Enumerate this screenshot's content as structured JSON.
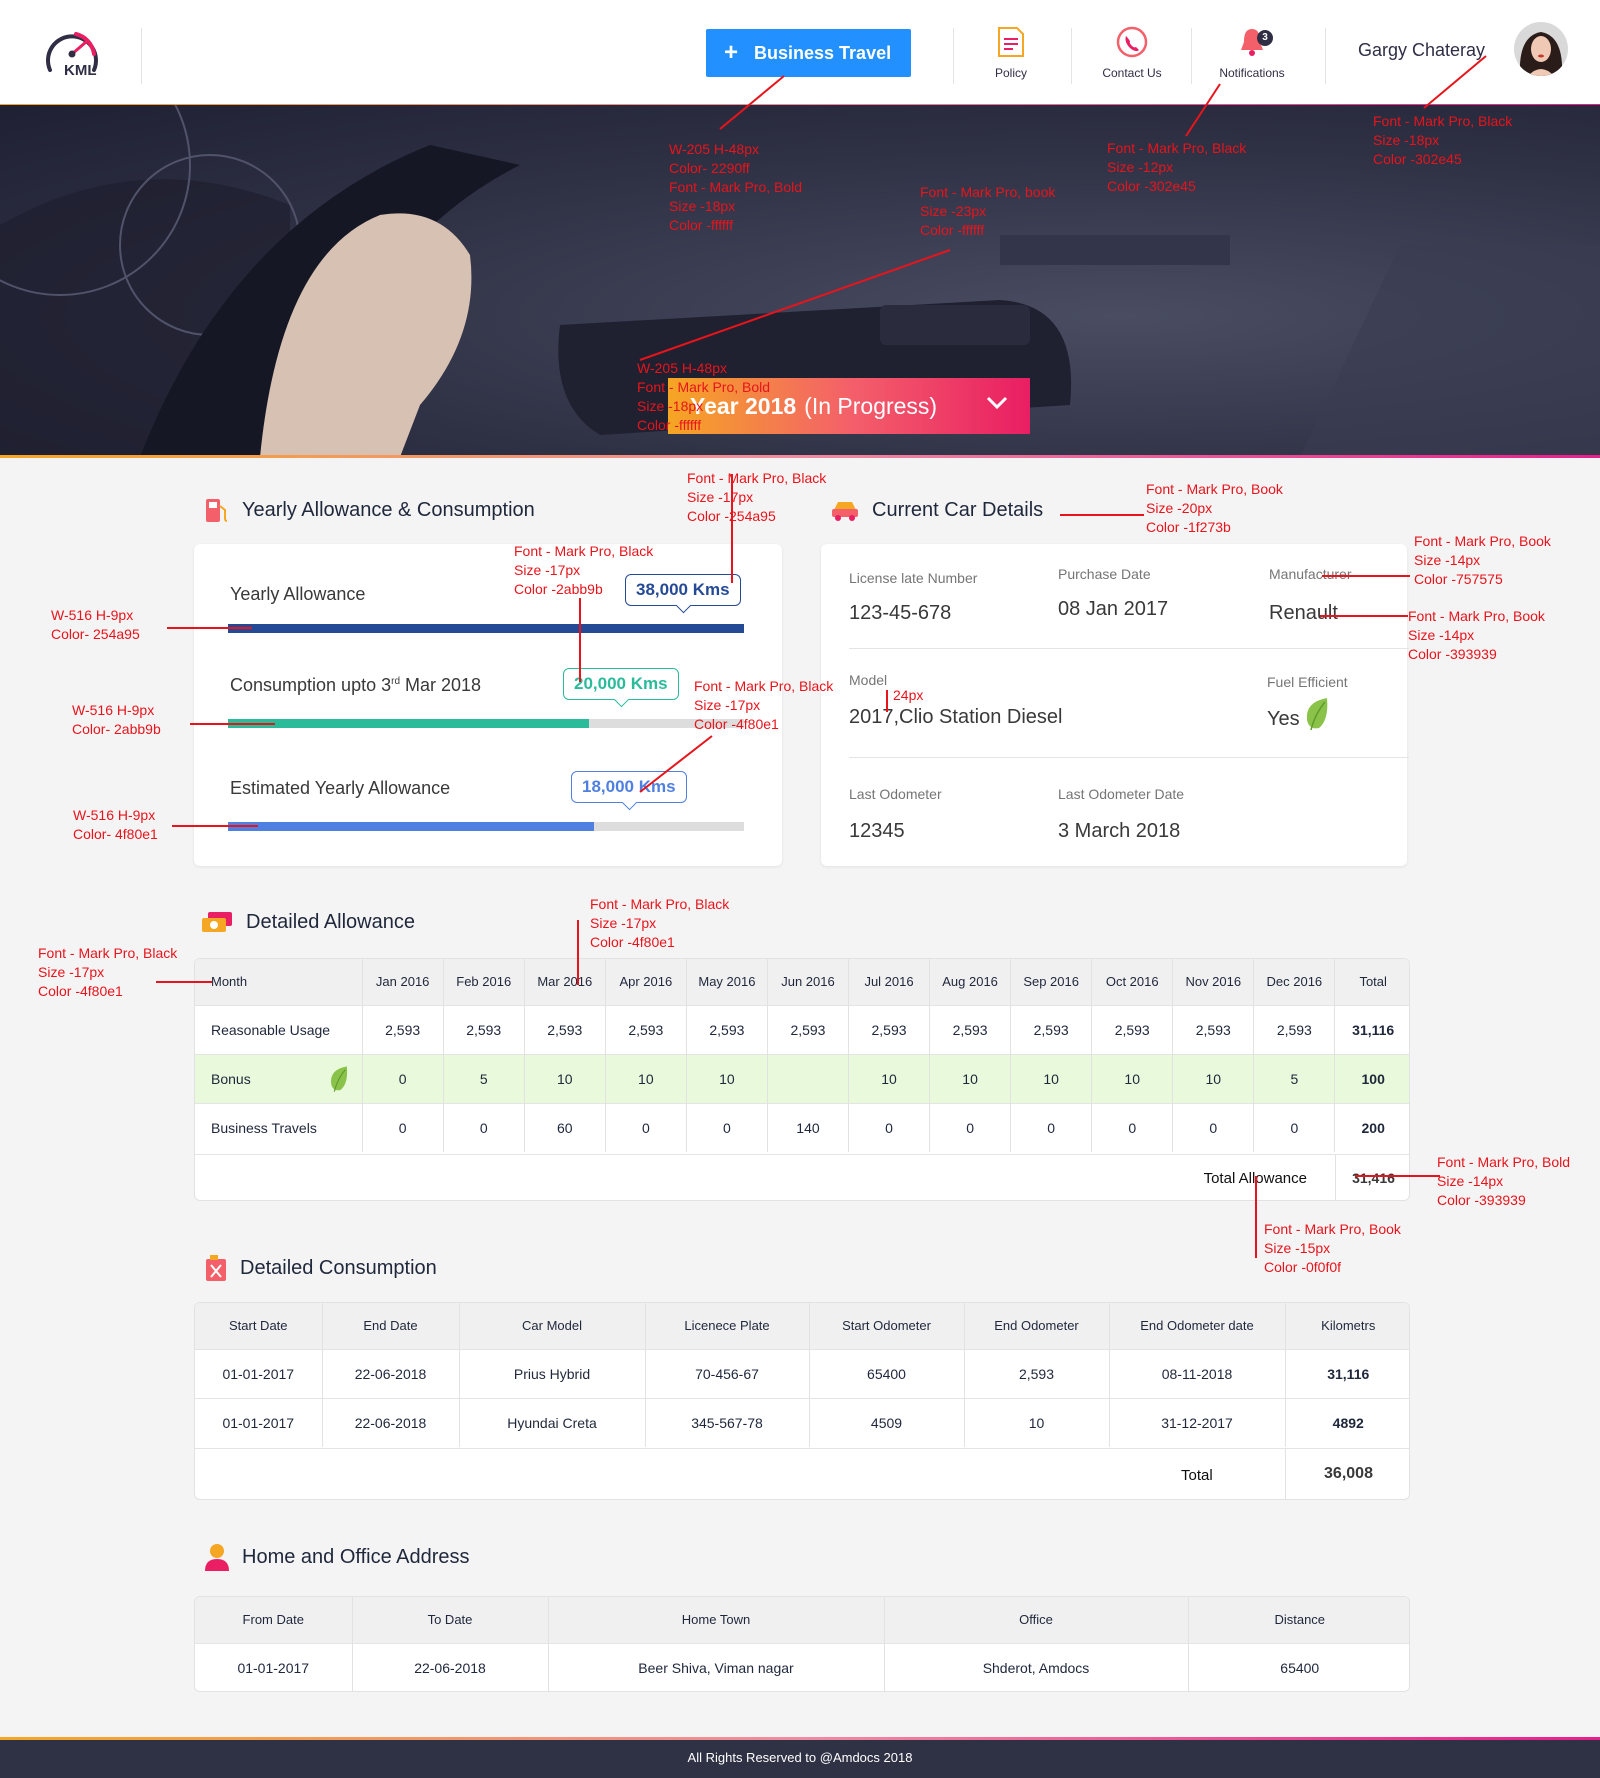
{
  "header": {
    "logo_text": "KML",
    "business_travel_label": "Business Travel",
    "nav": [
      {
        "label": "Policy",
        "icon": "policy-document-icon"
      },
      {
        "label": "Contact Us",
        "icon": "contact-phone-icon"
      },
      {
        "label": "Notifications",
        "icon": "bell-icon",
        "badge": "3"
      }
    ],
    "user_name": "Gargy Chateray"
  },
  "hero": {
    "year_bold": "Year 2018",
    "year_status": "(In Progress)"
  },
  "annotations": {
    "business_btn": [
      "W-205 H-48px",
      "Color- 2290ff",
      "Font - Mark Pro, Bold",
      "Size -18px",
      "Color -ffffff"
    ],
    "year_text": [
      "Font - Mark Pro, book",
      "Size -23px",
      "Color -ffffff"
    ],
    "year_box": [
      "W-205 H-48px",
      "Font - Mark Pro, Bold",
      "Size -18px",
      "Color -ffffff"
    ],
    "notifications": [
      "Font - Mark Pro, Black",
      "Size -12px",
      "Color -302e45"
    ],
    "username": [
      "Font - Mark Pro, Black",
      "Size -18px",
      "Color -302e45"
    ],
    "bubble_blue": [
      "Font - Mark Pro, Black",
      "Size -17px",
      "Color -254a95"
    ],
    "bubble_green": [
      "Font - Mark Pro, Black",
      "Size -17px",
      "Color -2abb9b"
    ],
    "bubble_light": [
      "Font - Mark Pro, Black",
      "Size -17px",
      "Color -4f80e1"
    ],
    "bar1": [
      "W-516 H-9px",
      "Color- 254a95"
    ],
    "bar2": [
      "W-516 H-9px",
      "Color- 2abb9b"
    ],
    "bar3": [
      "W-516 H-9px",
      "Color- 4f80e1"
    ],
    "car_title": [
      "Font - Mark Pro, Book",
      "Size -20px",
      "Color -1f273b"
    ],
    "car_label": [
      "Font - Mark Pro, Book",
      "Size -14px",
      "Color -757575"
    ],
    "car_value": [
      "Font - Mark Pro, Book",
      "Size -14px",
      "Color -393939"
    ],
    "model_gap": [
      "24px"
    ],
    "month_col": [
      "Font - Mark Pro, Black",
      "Size -17px",
      "Color -4f80e1"
    ],
    "month_header": [
      "Font - Mark Pro, Black",
      "Size -17px",
      "Color -4f80e1"
    ],
    "total_value": [
      "Font - Mark Pro, Bold",
      "Size -14px",
      "Color -393939"
    ],
    "total_label": [
      "Font - Mark Pro, Book",
      "Size -15px",
      "Color -0f0f0f"
    ]
  },
  "allowance": {
    "title": "Yearly Allowance & Consumption",
    "rows": [
      {
        "label": "Yearly Allowance",
        "bubble": "38,000 Kms",
        "fill": 1.0,
        "color": "#254a95"
      },
      {
        "label_pre": "Consumption upto 3",
        "label_sup": "rd",
        "label_post": " Mar 2018",
        "bubble": "20,000 Kms",
        "fill": 0.7,
        "color": "#2abb9b"
      },
      {
        "label": "Estimated Yearly Allowance",
        "bubble": "18,000 Kms",
        "fill": 0.71,
        "color": "#4f80e1"
      }
    ]
  },
  "car": {
    "title": "Current Car Details",
    "license_label": "License late Number",
    "license_value": "123-45-678",
    "purchase_label": "Purchase Date",
    "purchase_value": "08 Jan 2017",
    "manufacturer_label": "Manufacturer",
    "manufacturer_value": "Renault",
    "model_label": "Model",
    "model_value": "2017,Clio Station Diesel",
    "fuel_label": "Fuel Efficient",
    "fuel_value": "Yes",
    "odo_label": "Last Odometer",
    "odo_value": "12345",
    "odo_date_label": "Last Odometer Date",
    "odo_date_value": "3 March 2018"
  },
  "detailed_allowance": {
    "title": "Detailed Allowance",
    "headers": [
      "Month",
      "Jan 2016",
      "Feb 2016",
      "Mar 2016",
      "Apr 2016",
      "May 2016",
      "Jun 2016",
      "Jul 2016",
      "Aug 2016",
      "Sep 2016",
      "Oct 2016",
      "Nov 2016",
      "Dec 2016",
      "Total"
    ],
    "rows": [
      {
        "label": "Reasonable Usage",
        "values": [
          "2,593",
          "2,593",
          "2,593",
          "2,593",
          "2,593",
          "2,593",
          "2,593",
          "2,593",
          "2,593",
          "2,593",
          "2,593",
          "2,593"
        ],
        "total": "31,116"
      },
      {
        "label": "Bonus",
        "values": [
          "0",
          "5",
          "10",
          "10",
          "10",
          "",
          "10",
          "10",
          "10",
          "10",
          "10",
          "5"
        ],
        "total": "100"
      },
      {
        "label": "Business Travels",
        "values": [
          "0",
          "0",
          "60",
          "0",
          "0",
          "140",
          "0",
          "0",
          "0",
          "0",
          "0",
          "0"
        ],
        "total": "200"
      }
    ],
    "total_label": "Total Allowance",
    "total_value": "31,416"
  },
  "detailed_consumption": {
    "title": "Detailed Consumption",
    "headers": [
      "Start Date",
      "End Date",
      "Car Model",
      "Licenece Plate",
      "Start Odometer",
      "End Odometer",
      "End Odometer date",
      "Kilometrs"
    ],
    "rows": [
      [
        "01-01-2017",
        "22-06-2018",
        "Prius Hybrid",
        "70-456-67",
        "65400",
        "2,593",
        "08-11-2018",
        "31,116"
      ],
      [
        "01-01-2017",
        "22-06-2018",
        "Hyundai Creta",
        "345-567-78",
        "4509",
        "10",
        "31-12-2017",
        "4892"
      ]
    ],
    "total_label": "Total",
    "total_value": "36,008"
  },
  "address": {
    "title": "Home and Office Address",
    "headers": [
      "From Date",
      "To Date",
      "Home Town",
      "Office",
      "Distance"
    ],
    "rows": [
      [
        "01-01-2017",
        "22-06-2018",
        "Beer Shiva, Viman nagar",
        "Shderot, Amdocs",
        "65400"
      ]
    ]
  },
  "footer": {
    "text": "All Rights Reserved to @Amdocs 2018"
  },
  "colors": {
    "primary": "#2290ff",
    "text_dark": "#302e45",
    "bar_blue": "#254a95",
    "bar_green": "#2abb9b",
    "bar_light": "#4f80e1",
    "annotation": "#e8141b"
  }
}
